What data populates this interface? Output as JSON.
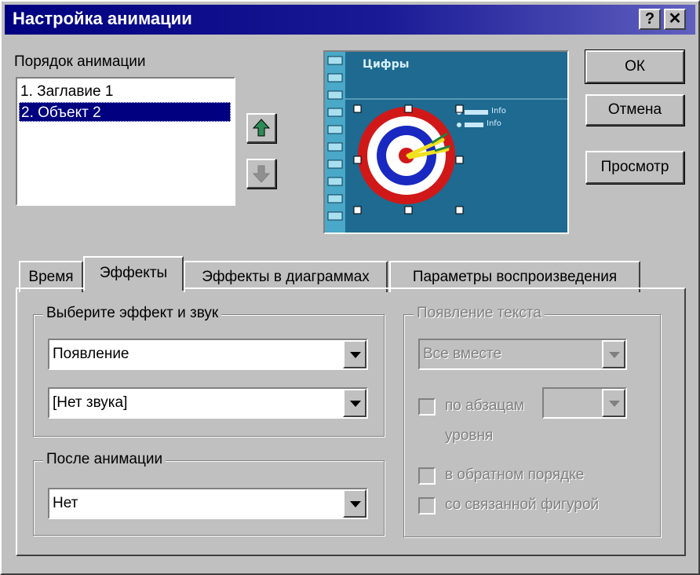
{
  "window": {
    "title": "Настройка анимации",
    "help_label": "?",
    "close_label": "✕"
  },
  "order": {
    "label": "Порядок анимации",
    "items": [
      {
        "label": "1. Заглавие 1",
        "selected": false
      },
      {
        "label": "2. Объект 2",
        "selected": true
      }
    ],
    "move_up_icon": "arrow-up-icon",
    "move_down_icon": "arrow-down-icon"
  },
  "preview": {
    "slide_title": "Цифры",
    "bullets": [
      "Info",
      "Info"
    ],
    "icon": "target-dart-clipart"
  },
  "buttons": {
    "ok": "ОК",
    "cancel": "Отмена",
    "preview": "Просмотр"
  },
  "tabs": [
    {
      "label": "Время",
      "active": false
    },
    {
      "label": "Эффекты",
      "active": true
    },
    {
      "label": "Эффекты в диаграммах",
      "active": false
    },
    {
      "label": "Параметры воспроизведения",
      "active": false
    }
  ],
  "effects": {
    "group_label": "Выберите эффект и звук",
    "effect_value": "Появление",
    "sound_value": "[Нет звука]"
  },
  "after": {
    "group_label": "После анимации",
    "value": "Нет"
  },
  "text_appear": {
    "group_label": "Появление текста",
    "mode_value": "Все вместе",
    "by_paragraph_label": "по абзацам",
    "level_label": "уровня",
    "reverse_label": "в обратном порядке",
    "with_shape_label": "со связанной фигурой"
  },
  "colors": {
    "titlebar": "#000080",
    "preview_bg": "#1e6a90",
    "selection": "#000080"
  }
}
